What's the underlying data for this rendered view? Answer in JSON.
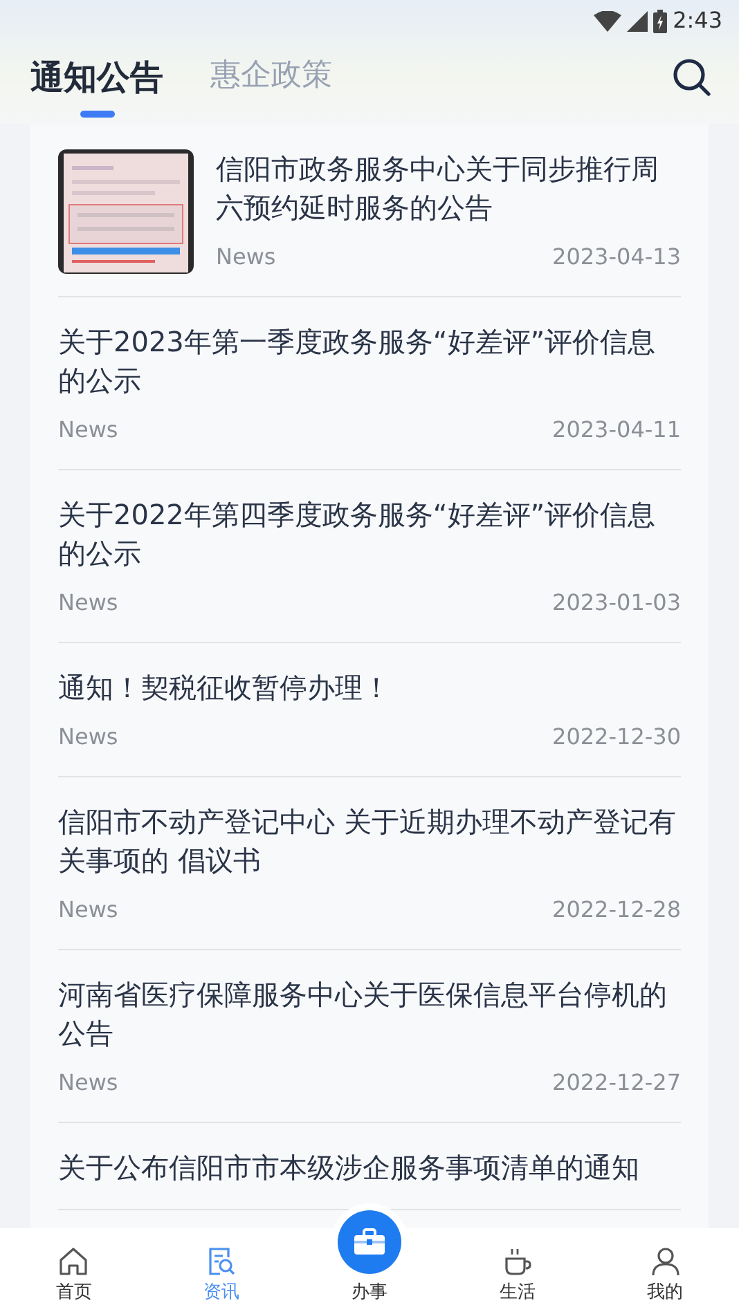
{
  "status_bar": {
    "time": "2:43"
  },
  "tabs": [
    {
      "label": "通知公告",
      "selected": true
    },
    {
      "label": "惠企政策",
      "selected": false
    }
  ],
  "articles": [
    {
      "title": "信阳市政务服务中心关于同步推行周六预约延时服务的公告",
      "source": "News",
      "date": "2023-04-13"
    },
    {
      "title": "关于2023年第一季度政务服务“好差评”评价信息的公示",
      "source": "News",
      "date": "2023-04-11"
    },
    {
      "title": "关于2022年第四季度政务服务“好差评”评价信息的公示",
      "source": "News",
      "date": "2023-01-03"
    },
    {
      "title": "通知！契税征收暂停办理！",
      "source": "News",
      "date": "2022-12-30"
    },
    {
      "title": "信阳市不动产登记中心 关于近期办理不动产登记有关事项的 倡议书",
      "source": "News",
      "date": "2022-12-28"
    },
    {
      "title": "河南省医疗保障服务中心关于医保信息平台停机的公告",
      "source": "News",
      "date": "2022-12-27"
    },
    {
      "title": "关于公布信阳市市本级涉企服务事项清单的通知"
    }
  ],
  "bottom_nav": [
    {
      "kind": "home",
      "label": "首页",
      "selected": false
    },
    {
      "kind": "news",
      "label": "资讯",
      "selected": true
    },
    {
      "kind": "center",
      "label": "办事",
      "selected": false
    },
    {
      "kind": "life",
      "label": "生活",
      "selected": false
    },
    {
      "kind": "me",
      "label": "我的",
      "selected": false
    }
  ]
}
